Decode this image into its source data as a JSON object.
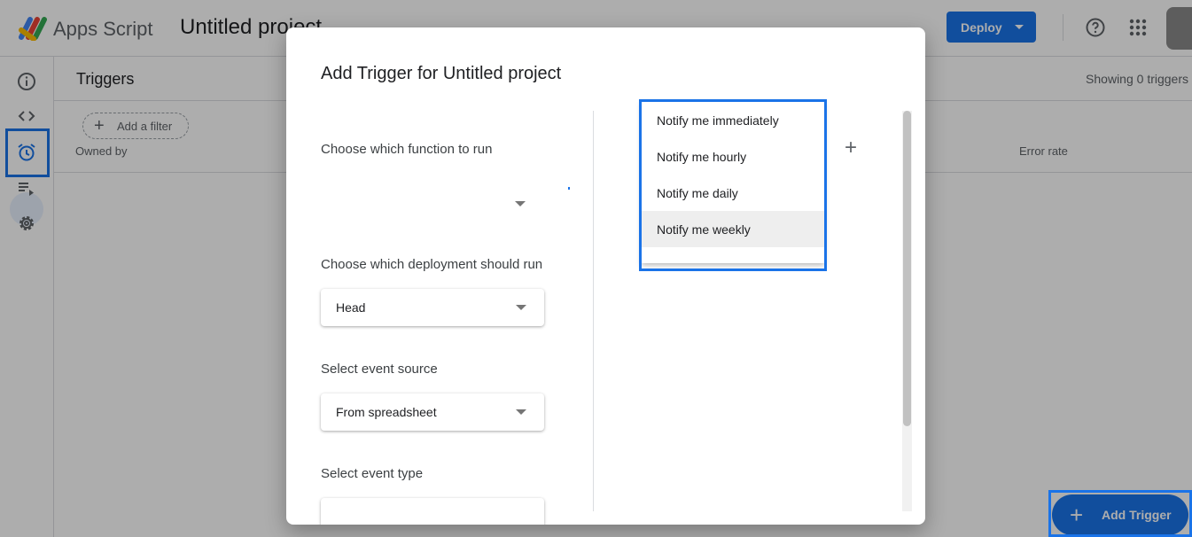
{
  "app": {
    "name": "Apps Script",
    "project_title": "Untitled project",
    "deploy_label": "Deploy"
  },
  "icons": {
    "logo": "apps-script-logo",
    "help": "help-circle-icon",
    "apps": "apps-grid-icon",
    "nav": [
      "info-icon",
      "code-icon",
      "alarm-clock-icon",
      "executions-icon",
      "gear-icon"
    ]
  },
  "triggers_page": {
    "title": "Triggers",
    "count_text": "Showing 0 triggers",
    "filter_label": "Add a filter",
    "columns": [
      "Owned by",
      "Error rate"
    ],
    "add_button_label": "Add Trigger"
  },
  "dialog": {
    "title": "Add Trigger for Untitled project",
    "function_label": "Choose which function to run",
    "function_value": "",
    "deployment_label": "Choose which deployment should run",
    "deployment_value": "Head",
    "event_source_label": "Select event source",
    "event_source_value": "From spreadsheet",
    "event_type_label": "Select event type",
    "event_type_value": "",
    "notification_options": [
      "Notify me immediately",
      "Notify me hourly",
      "Notify me daily",
      "Notify me weekly"
    ],
    "notification_selected": "Notify me weekly",
    "add_notification_symbol": "+"
  },
  "colors": {
    "accent": "#1a73e8",
    "highlight": "#1a73e8",
    "menu_selected": "#eeeeee"
  }
}
